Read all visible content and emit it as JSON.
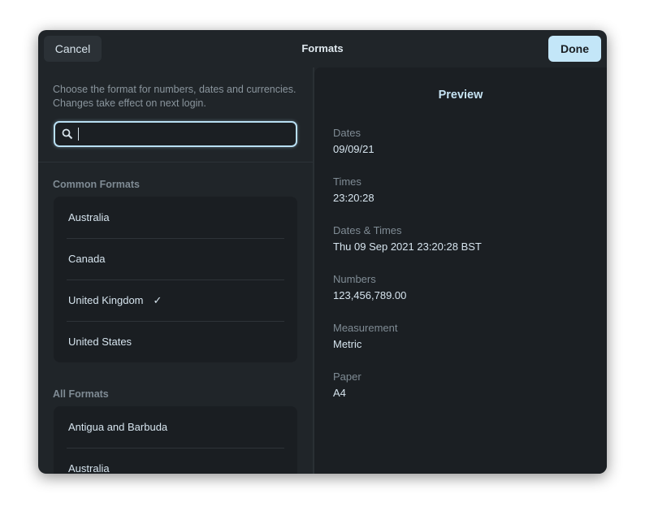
{
  "header": {
    "title": "Formats",
    "cancel_label": "Cancel",
    "done_label": "Done",
    "accent": "#c3e6f8"
  },
  "left": {
    "description": "Choose the format for numbers, dates and currencies. Changes take effect on next login.",
    "search": {
      "value": "",
      "icon": "search-icon"
    },
    "common_title": "Common Formats",
    "common": [
      {
        "label": "Australia"
      },
      {
        "label": "Canada"
      },
      {
        "label": "United Kingdom",
        "selected": true
      },
      {
        "label": "United States"
      }
    ],
    "all_title": "All Formats",
    "all": [
      {
        "label": "Antigua and Barbuda"
      },
      {
        "label": "Australia"
      }
    ]
  },
  "preview": {
    "title": "Preview",
    "items": [
      {
        "label": "Dates",
        "value": "09/09/21"
      },
      {
        "label": "Times",
        "value": "23:20:28"
      },
      {
        "label": "Dates & Times",
        "value": "Thu 09 Sep 2021 23:20:28 BST"
      },
      {
        "label": "Numbers",
        "value": "123,456,789.00"
      },
      {
        "label": "Measurement",
        "value": "Metric"
      },
      {
        "label": "Paper",
        "value": "A4"
      }
    ]
  }
}
